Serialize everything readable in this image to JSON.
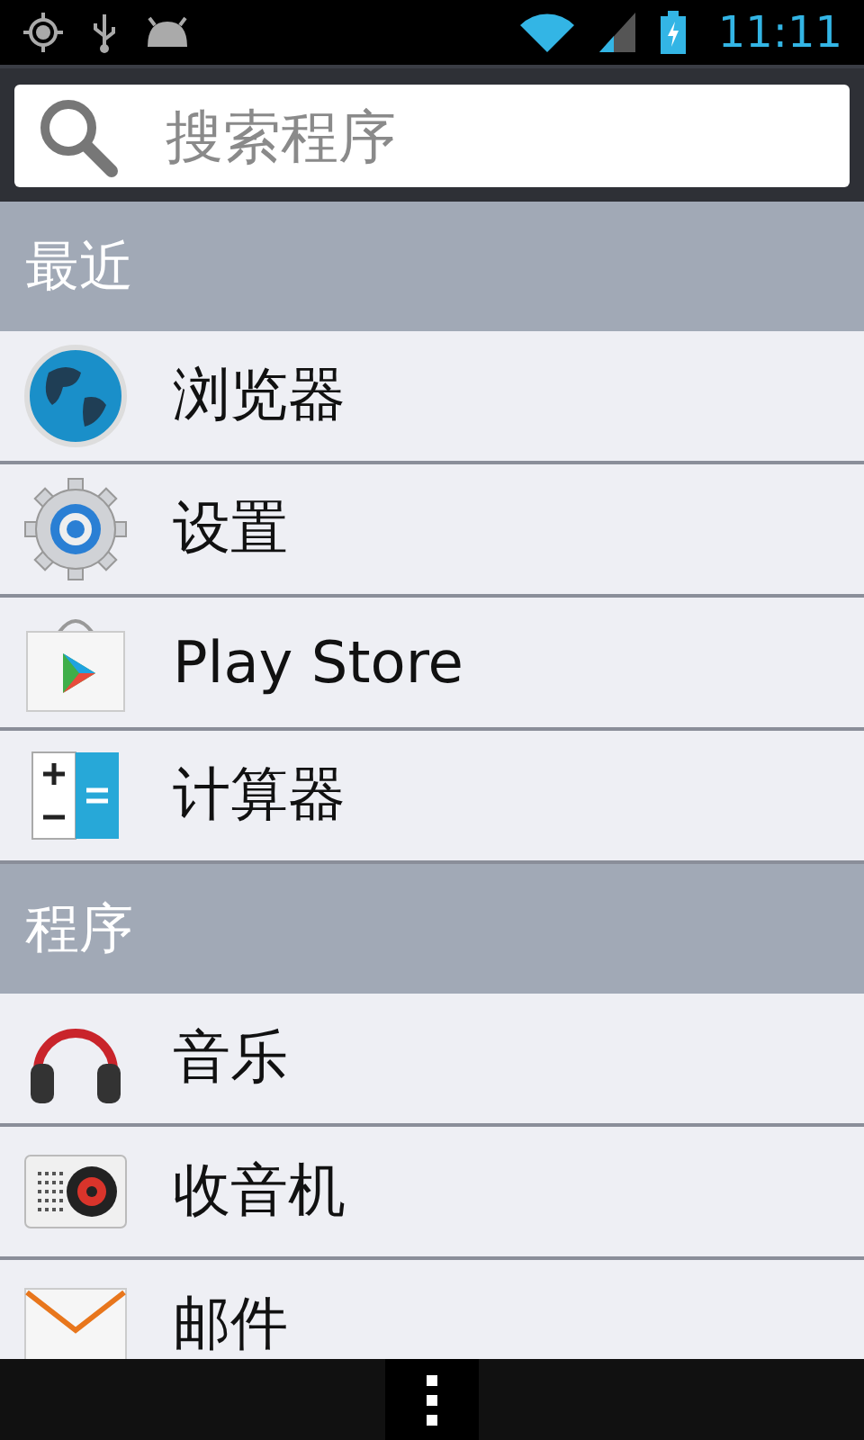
{
  "status_bar": {
    "time": "11:11"
  },
  "search": {
    "placeholder": "搜索程序"
  },
  "sections": [
    {
      "title": "最近",
      "items": [
        {
          "label": "浏览器",
          "kind": "globe"
        },
        {
          "label": "设置",
          "kind": "gear"
        },
        {
          "label": "Play Store",
          "kind": "store"
        },
        {
          "label": "计算器",
          "kind": "calculator"
        }
      ]
    },
    {
      "title": "程序",
      "items": [
        {
          "label": "音乐",
          "kind": "headphones"
        },
        {
          "label": "收音机",
          "kind": "radio"
        },
        {
          "label": "邮件",
          "kind": "mail"
        }
      ]
    }
  ]
}
